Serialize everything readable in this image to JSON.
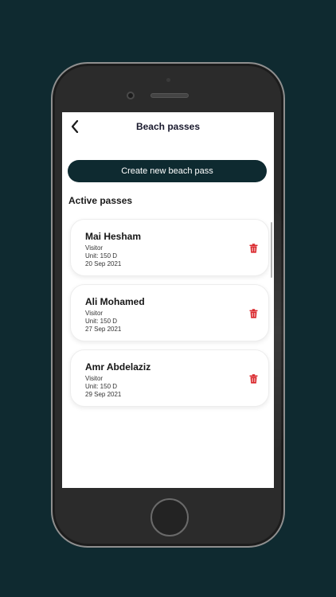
{
  "header": {
    "title": "Beach passes",
    "back_icon": "chevron-left-icon"
  },
  "actions": {
    "create_label": "Create new beach pass"
  },
  "section": {
    "title": "Active passes"
  },
  "passes": [
    {
      "name": "Mai Hesham",
      "type": "Visitor",
      "unit": "Unit: 150 D",
      "date": "20 Sep 2021"
    },
    {
      "name": "Ali Mohamed",
      "type": "Visitor",
      "unit": "Unit: 150 D",
      "date": "27 Sep 2021"
    },
    {
      "name": "Amr Abdelaziz",
      "type": "Visitor",
      "unit": "Unit: 150 D",
      "date": "29 Sep 2021"
    }
  ],
  "colors": {
    "background": "#0f2a30",
    "primary_button": "#0e2a30",
    "delete_icon": "#d9252a"
  }
}
